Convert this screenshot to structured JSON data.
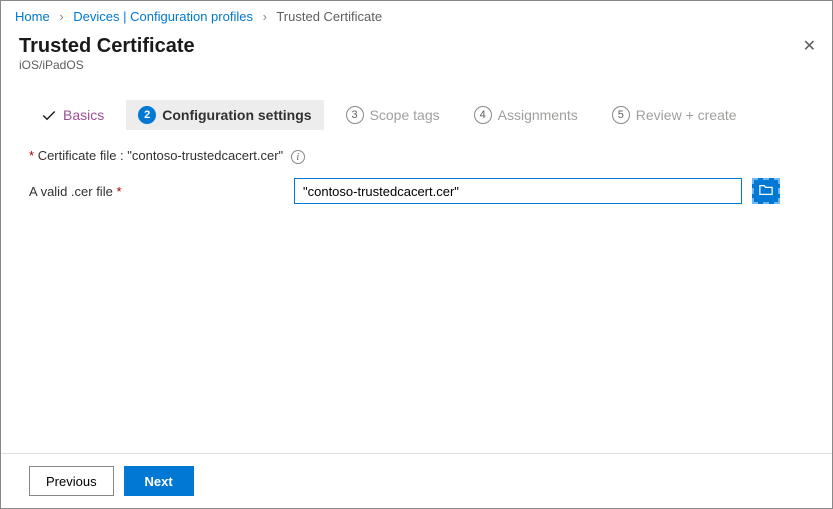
{
  "breadcrumb": {
    "home": "Home",
    "devices": "Devices | Configuration profiles",
    "current": "Trusted Certificate"
  },
  "header": {
    "title": "Trusted Certificate",
    "subtitle": "iOS/iPadOS"
  },
  "steps": {
    "s1": {
      "label": "Basics"
    },
    "s2": {
      "num": "2",
      "label": "Configuration settings"
    },
    "s3": {
      "num": "3",
      "label": "Scope tags"
    },
    "s4": {
      "num": "4",
      "label": "Assignments"
    },
    "s5": {
      "num": "5",
      "label": "Review + create"
    }
  },
  "form": {
    "certLabel": "Certificate file : \"contoso-trustedcacert.cer\"",
    "fieldLabel": "A valid .cer file",
    "fieldValue": "\"contoso-trustedcacert.cer\""
  },
  "footer": {
    "previous": "Previous",
    "next": "Next"
  }
}
